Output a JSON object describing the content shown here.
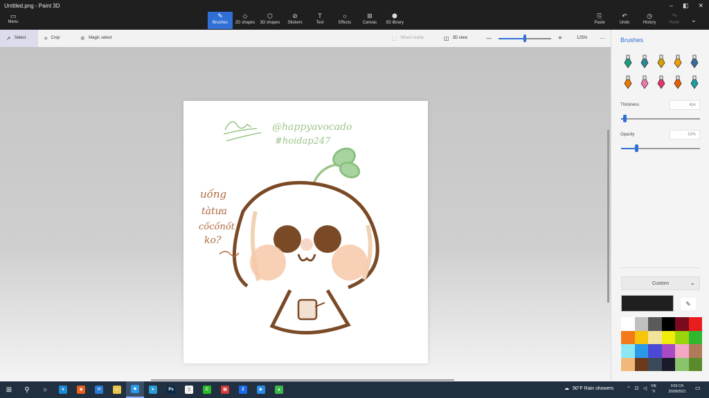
{
  "window": {
    "title": "Untitled.png - Paint 3D",
    "controls": [
      "–",
      "◧",
      "✕"
    ]
  },
  "menu": {
    "label": "Menu"
  },
  "tools": [
    {
      "key": "brushes",
      "label": "Brushes",
      "glyph": "✎",
      "active": true
    },
    {
      "key": "2d-shapes",
      "label": "2D shapes",
      "glyph": "◇"
    },
    {
      "key": "3d-shapes",
      "label": "3D shapes",
      "glyph": "⬡"
    },
    {
      "key": "stickers",
      "label": "Stickers",
      "glyph": "⊘"
    },
    {
      "key": "text",
      "label": "Text",
      "glyph": "T"
    },
    {
      "key": "effects",
      "label": "Effects",
      "glyph": "☼"
    },
    {
      "key": "canvas",
      "label": "Canvas",
      "glyph": "⊞"
    },
    {
      "key": "3d-library",
      "label": "3D library",
      "glyph": "⬢"
    }
  ],
  "right_tools": [
    {
      "key": "paste",
      "label": "Paste",
      "glyph": "⎘"
    },
    {
      "key": "undo",
      "label": "Undo",
      "glyph": "↶"
    },
    {
      "key": "history",
      "label": "History",
      "glyph": "◷"
    },
    {
      "key": "redo",
      "label": "Redo",
      "glyph": "↷",
      "disabled": true
    }
  ],
  "subbar": {
    "select": "Select",
    "crop": "Crop",
    "magic_select": "Magic select",
    "mixed_reality": "Mixed reality",
    "view_3d": "3D view",
    "zoom_minus": "—",
    "zoom_plus": "+",
    "zoom_level": "125%",
    "zoom_fraction": 0.5,
    "more": "···"
  },
  "panel": {
    "title": "Brushes",
    "brushes": [
      {
        "name": "marker",
        "color": "#1a9e7e"
      },
      {
        "name": "calligraphy-pen",
        "color": "#2a8a9a"
      },
      {
        "name": "oil-brush",
        "color": "#d8a000"
      },
      {
        "name": "watercolor",
        "color": "#f0a000"
      },
      {
        "name": "pixel-pen",
        "color": "#3a6a9a"
      },
      {
        "name": "pencil",
        "color": "#e87a00"
      },
      {
        "name": "eraser",
        "color": "#e87ab0"
      },
      {
        "name": "crayon",
        "color": "#e8336a"
      },
      {
        "name": "spray-can",
        "color": "#e86000"
      },
      {
        "name": "fill",
        "color": "#1a9e9e"
      }
    ],
    "thickness_label": "Thickness",
    "thickness_value": "4px",
    "thickness_fraction": 0.04,
    "opacity_label": "Opacity",
    "opacity_value": "19%",
    "opacity_fraction": 0.19,
    "color_mode": "Custom",
    "current_color": "#1e1e1e",
    "palette": [
      "#ffffff",
      "#c0c0c0",
      "#5a5a5a",
      "#000000",
      "#7a0a1e",
      "#e81e1e",
      "#f27a1a",
      "#f7c40a",
      "#f2e39a",
      "#f2ec0a",
      "#9ad40a",
      "#2fb82f",
      "#8ae8f2",
      "#2a9ae8",
      "#4a4ad4",
      "#a84ac4",
      "#f2a8c4",
      "#b07a5a",
      "#f2b87a",
      "#6a3a1a",
      "#3a4a5a",
      "#1a1a2a",
      "#8ac46a",
      "#5a8a2a"
    ]
  },
  "canvas_text": {
    "handle": "@happyavocado",
    "hashtag": "#hoidap247",
    "line1": "uống",
    "line2": "tàtưa",
    "line3": "cốcốnốt",
    "line4": "ko?"
  },
  "taskbar": {
    "apps": [
      {
        "name": "windows-start-icon",
        "glyph": "⊞"
      },
      {
        "name": "search-icon",
        "glyph": "⚲"
      },
      {
        "name": "task-view-icon",
        "glyph": "○"
      },
      {
        "name": "edge-icon",
        "color": "#1a8ad4",
        "glyph": "e"
      },
      {
        "name": "firefox-icon",
        "color": "#e8601a",
        "glyph": "◉"
      },
      {
        "name": "mail-icon",
        "color": "#2a7ad4",
        "glyph": "✉"
      },
      {
        "name": "folder-icon",
        "color": "#e8c44a",
        "glyph": "▭"
      },
      {
        "name": "paint3d-icon",
        "color": "#2a9ae8",
        "glyph": "◆",
        "active": true
      },
      {
        "name": "telegram-icon",
        "color": "#2a9ad4",
        "glyph": "➤"
      },
      {
        "name": "photoshop-icon",
        "color": "#0a2a4a",
        "glyph": "Ps"
      },
      {
        "name": "notepad-icon",
        "color": "#f2f2f2",
        "glyph": "▯"
      },
      {
        "name": "camtasia-icon",
        "color": "#2ab82a",
        "glyph": "C"
      },
      {
        "name": "app-icon",
        "color": "#d43a3a",
        "glyph": "▦"
      },
      {
        "name": "zalo-icon",
        "color": "#1a6ae8",
        "glyph": "Z"
      },
      {
        "name": "zoom-icon",
        "color": "#2a8ae8",
        "glyph": "▶"
      },
      {
        "name": "drive-icon",
        "color": "#3ab84a",
        "glyph": "▲"
      }
    ],
    "weather": "90°F  Rain showers",
    "lang_top": "VIE",
    "lang_bottom": "TI",
    "time": "9:53 CH",
    "date": "25/08/2021"
  }
}
